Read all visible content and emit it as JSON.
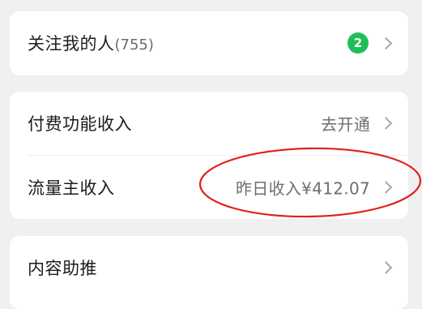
{
  "followers": {
    "label": "关注我的人",
    "count": "(755)",
    "badge": "2"
  },
  "income": {
    "paid_features": {
      "label": "付费功能收入",
      "value": "去开通"
    },
    "traffic_owner": {
      "label": "流量主收入",
      "value": "昨日收入¥412.07"
    }
  },
  "content_boost": {
    "label": "内容助推"
  },
  "colors": {
    "background": "#f0f0f2",
    "badge": "#1fbf58",
    "annotation": "#e02020"
  },
  "icons": [
    "chevron-right-icon"
  ]
}
